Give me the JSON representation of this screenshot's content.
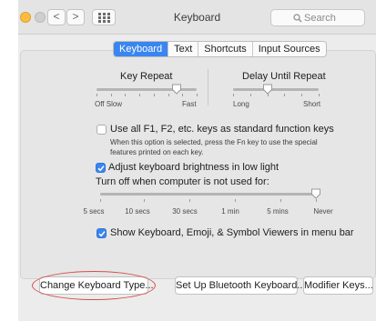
{
  "window": {
    "title": "Keyboard",
    "search_placeholder": "Search",
    "back_glyph": "<",
    "forward_glyph": ">"
  },
  "tabs": [
    {
      "label": "Keyboard",
      "selected": true
    },
    {
      "label": "Text",
      "selected": false
    },
    {
      "label": "Shortcuts",
      "selected": false
    },
    {
      "label": "Input Sources",
      "selected": false
    }
  ],
  "key_repeat": {
    "title": "Key Repeat",
    "min_label": "Off Slow",
    "max_label": "Fast",
    "value": 0.8
  },
  "delay_until_repeat": {
    "title": "Delay Until Repeat",
    "min_label": "Long",
    "max_label": "Short",
    "value": 0.4
  },
  "function_keys": {
    "label": "Use all F1, F2, etc. keys as standard function keys",
    "description": "When this option is selected, press the Fn key to use the special features printed on each key.",
    "checked": false
  },
  "brightness": {
    "label": "Adjust keyboard brightness in low light",
    "checked": true
  },
  "backlight_off": {
    "title": "Turn off when computer is not used for:",
    "stops": [
      "5 secs",
      "10 secs",
      "30 secs",
      "1 min",
      "5 mins",
      "Never"
    ],
    "value": "Never"
  },
  "viewers_menu": {
    "label": "Show Keyboard, Emoji, & Symbol Viewers in menu bar",
    "checked": true
  },
  "buttons": {
    "change_type": "Change Keyboard Type...",
    "bluetooth": "Set Up Bluetooth Keyboard...",
    "modifier": "Modifier Keys..."
  },
  "colors": {
    "accent": "#3a86f0",
    "annotation": "#d4504e"
  },
  "icons": {
    "grid": "grid-icon",
    "search": "search-icon",
    "checkmark": "checkmark-icon"
  }
}
